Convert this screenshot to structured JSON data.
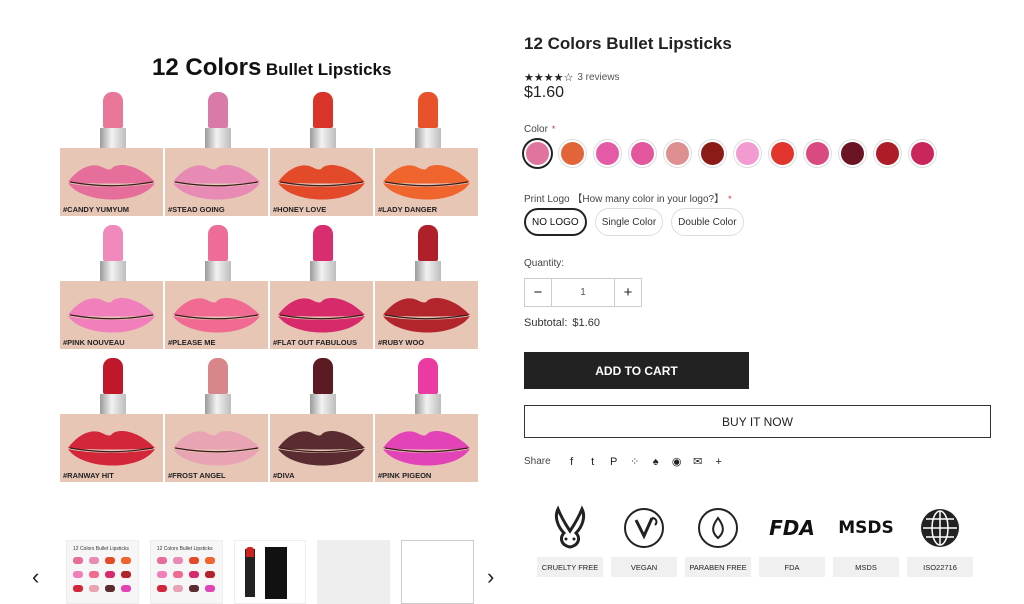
{
  "product": {
    "title": "12 Colors Bullet Lipsticks",
    "stars": "★★★★☆",
    "reviews": "3 reviews",
    "price": "$1.60"
  },
  "gallery": {
    "title_big": "12 Colors",
    "title_small": "Bullet Lipsticks",
    "shades": [
      {
        "name": "#CANDY YUMYUM",
        "stick": "#e8779a",
        "lip": "#e66e9a"
      },
      {
        "name": "#STEAD GOING",
        "stick": "#d97aa8",
        "lip": "#e78ab4"
      },
      {
        "name": "#HONEY LOVE",
        "stick": "#d9332a",
        "lip": "#e24a2a"
      },
      {
        "name": "#LADY DANGER",
        "stick": "#e8522a",
        "lip": "#f0652e"
      },
      {
        "name": "#PINK NOUVEAU",
        "stick": "#f08abd",
        "lip": "#f07fbb"
      },
      {
        "name": "#PLEASE ME",
        "stick": "#ee6c98",
        "lip": "#f06a92"
      },
      {
        "name": "#FLAT OUT FABULOUS",
        "stick": "#d82d6e",
        "lip": "#d72a6a"
      },
      {
        "name": "#RUBY WOO",
        "stick": "#b0202b",
        "lip": "#b3252c"
      },
      {
        "name": "#RANWAY HIT",
        "stick": "#c0172b",
        "lip": "#d3263a"
      },
      {
        "name": "#FROST ANGEL",
        "stick": "#d8868a",
        "lip": "#e9a4b4"
      },
      {
        "name": "#DIVA",
        "stick": "#5c1a22",
        "lip": "#5a2b30"
      },
      {
        "name": "#PINK PIGEON",
        "stick": "#ec3aa3",
        "lip": "#e244b7"
      }
    ],
    "thumb_title": "12 Colors Bullet Lipsticks"
  },
  "options": {
    "color_label": "Color",
    "required_mark": "*",
    "colors": [
      "#e0749f",
      "#e2653a",
      "#e45aa6",
      "#e2579e",
      "#de9090",
      "#8c1b18",
      "#f29bd0",
      "#e1352d",
      "#d94a80",
      "#6b1424",
      "#ad1c27",
      "#c9265c"
    ],
    "logo_label": "Print Logo 【How many color in your logo?】",
    "logo_options": [
      "NO LOGO",
      "Single Color",
      "Double Color"
    ]
  },
  "quantity": {
    "label": "Quantity:",
    "minus": "−",
    "value": "1",
    "plus": "+"
  },
  "subtotal": {
    "label": "Subtotal:",
    "value": "$1.60"
  },
  "actions": {
    "add_to_cart": "ADD TO CART",
    "buy_now": "BUY IT NOW"
  },
  "share": {
    "label": "Share",
    "icons": [
      "facebook-icon",
      "twitter-icon",
      "pinterest-icon",
      "tumblr-icon",
      "snapchat-icon",
      "reddit-icon",
      "email-icon",
      "more-icon"
    ],
    "glyphs": [
      "f",
      "t",
      "P",
      "⁘",
      "♠",
      "◉",
      "✉",
      "+"
    ]
  },
  "badges": [
    {
      "caption": "CRUELTY FREE",
      "icon": "bunny-icon"
    },
    {
      "caption": "VEGAN",
      "icon": "vegan-icon"
    },
    {
      "caption": "PARABEN FREE",
      "icon": "paraben-free-icon"
    },
    {
      "caption": "FDA",
      "icon": "fda-icon",
      "mark": "FDA"
    },
    {
      "caption": "MSDS",
      "icon": "msds-icon",
      "mark": "MSDS"
    },
    {
      "caption": "ISO22716",
      "icon": "globe-icon"
    }
  ],
  "navigation": {
    "prev": "‹",
    "next": "›"
  }
}
